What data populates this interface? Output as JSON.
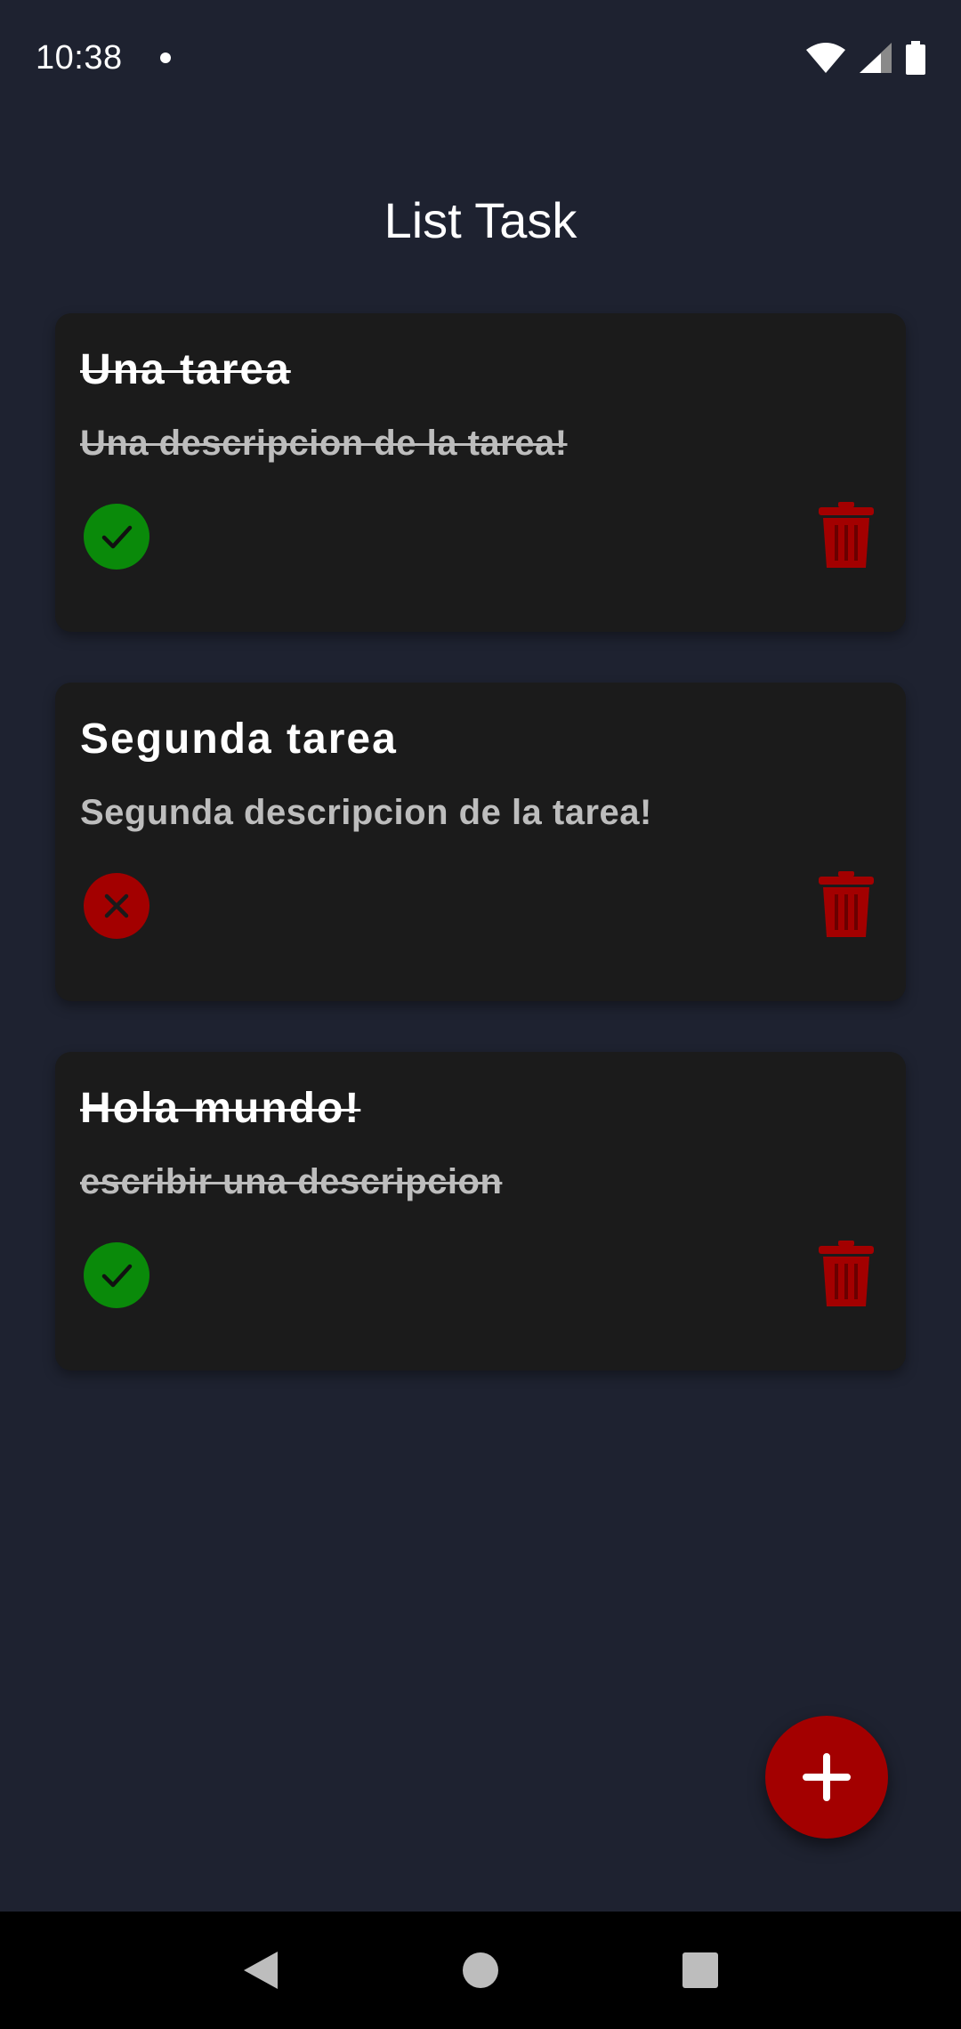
{
  "status_bar": {
    "time": "10:38",
    "icons": [
      "notification-dot-icon",
      "wifi-icon",
      "cell-signal-icon",
      "battery-icon"
    ]
  },
  "page": {
    "title": "List Task"
  },
  "tasks": [
    {
      "title": "Una tarea",
      "description": "Una descripcion de la tarea!",
      "completed": true,
      "status_icon": "check-icon",
      "delete_icon": "trash-icon"
    },
    {
      "title": "Segunda tarea",
      "description": "Segunda descripcion de la tarea!",
      "completed": false,
      "status_icon": "close-icon",
      "delete_icon": "trash-icon"
    },
    {
      "title": "Hola mundo!",
      "description": "escribir una descripcion",
      "completed": true,
      "status_icon": "check-icon",
      "delete_icon": "trash-icon"
    }
  ],
  "fab": {
    "icon": "plus-icon"
  },
  "nav_bar": {
    "icons": [
      "back-icon",
      "home-icon",
      "recents-icon"
    ]
  },
  "colors": {
    "background": "#1e2230",
    "card": "#1b1b1b",
    "accent_red": "#a30000",
    "complete_green": "#0a8a0a",
    "description_text": "#bdbdbd"
  }
}
